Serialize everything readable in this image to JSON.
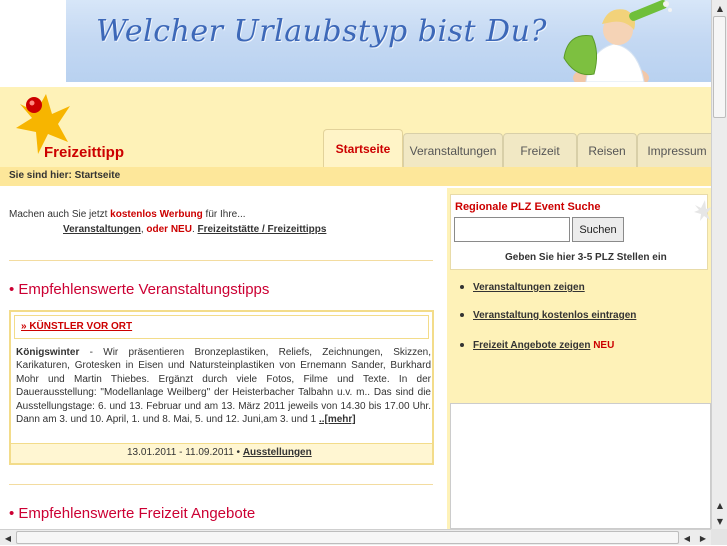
{
  "banner": {
    "text": "Welcher Urlaubstyp bist Du?",
    "background_color": "#c5d9f3",
    "text_color": "#3d68b8"
  },
  "logo": {
    "text": "Freizeittipp",
    "star_color": "#f7b500",
    "dot_color": "#cc0000"
  },
  "nav": {
    "tabs": [
      {
        "label": "Startseite",
        "active": true
      },
      {
        "label": "Veranstaltungen",
        "active": false
      },
      {
        "label": "Freizeit",
        "active": false
      },
      {
        "label": "Reisen",
        "active": false
      },
      {
        "label": "Impressum",
        "active": false
      }
    ]
  },
  "breadcrumb": {
    "text": "Sie sind hier: Startseite"
  },
  "promo": {
    "prefix": "Machen auch Sie jetzt ",
    "highlight": "kostenlos Werbung",
    "suffix": " für Ihre...",
    "link1": "Veranstaltungen",
    "sep1": ", ",
    "oder_neu": "oder NEU",
    "sep2": ". ",
    "link2": "Freizeitstätte / Freizeittipps"
  },
  "sections": {
    "events_title": "• Empfehlenswerte Veranstaltungstipps",
    "leisure_title": "• Empfehlenswerte Freizeit Angebote"
  },
  "event": {
    "category": "» KÜNSTLER VOR ORT",
    "location": "Königswinter",
    "description": " - Wir präsentieren Bronzeplastiken, Reliefs, Zeichnungen, Skizzen, Karikaturen, Grotesken in Eisen und Natursteinplastiken von Ernemann Sander, Burkhard Mohr und Martin Thiebes. Ergänzt durch viele Fotos, Filme und Texte. In der Dauerausstellung: \"Modellanlage Weilberg\" der Heisterbacher Talbahn u.v. m.. Das sind die Ausstellungstage: 6. und 13. Februar und am 13. März 2011 jeweils von 14.30 bis 17.00 Uhr. Dann am 3. und 10. April, 1. und 8. Mai, 5. und 12. Juni,am 3. und 1 ",
    "more": "..[mehr]",
    "date_range": "13.01.2011 - 11.09.2011 • ",
    "type_link": "Ausstellungen"
  },
  "search": {
    "title": "Regionale PLZ Event Suche",
    "input_value": "",
    "button_label": "Suchen",
    "hint": "Geben Sie hier 3-5 PLZ Stellen ein"
  },
  "right_links": [
    {
      "label": "Veranstaltungen zeigen",
      "badge": ""
    },
    {
      "label": "Veranstaltung kostenlos eintragen",
      "badge": ""
    },
    {
      "label": "Freizeit Angebote zeigen",
      "badge": "NEU"
    }
  ],
  "colors": {
    "header_bg": "#fef2b8",
    "breadcrumb_bg": "#fde79a",
    "accent_red": "#cc0000",
    "section_title": "#cc0033"
  }
}
